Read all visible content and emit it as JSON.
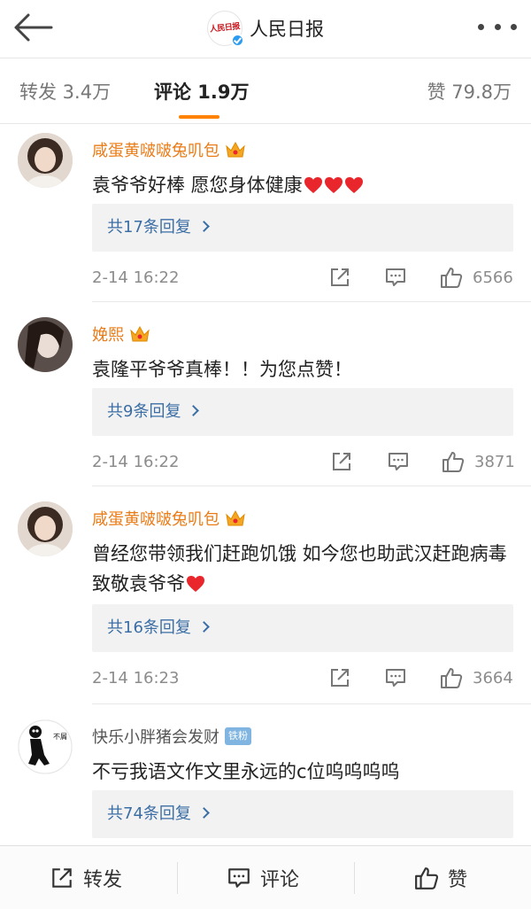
{
  "header": {
    "title": "人民日报",
    "logo_text": "人民日报"
  },
  "tabs": {
    "repost": "转发 3.4万",
    "comments": "评论 1.9万",
    "likes": "赞 79.8万"
  },
  "comments": [
    {
      "user": "咸蛋黄啵啵兔叽包",
      "text": "袁爷爷好棒 愿您身体健康",
      "hearts": 3,
      "replies": "共17条回复",
      "time": "2-14 16:22",
      "likes": "6566"
    },
    {
      "user": "娩熙",
      "text": "袁隆平爷爷真棒！！为您点赞！",
      "hearts": 0,
      "replies": "共9条回复",
      "time": "2-14 16:22",
      "likes": "3871"
    },
    {
      "user": "咸蛋黄啵啵兔叽包",
      "text": "曾经您带领我们赶跑饥饿 如今您也助武汉赶跑病毒 致敬袁爷爷",
      "hearts": 1,
      "replies": "共16条回复",
      "time": "2-14 16:23",
      "likes": "3664"
    },
    {
      "user": "快乐小胖猪会发财",
      "badge": "铁粉",
      "avatar_text": "不屑",
      "text": "不亏我语文作文里永远的c位呜呜呜呜",
      "hearts": 0,
      "replies": "共74条回复"
    }
  ],
  "bottom_bar": {
    "repost": "转发",
    "comment": "评论",
    "like": "赞"
  },
  "colors": {
    "accent": "#ff8200",
    "username": "#ea7c18",
    "link": "#3b6ea5",
    "heart": "#e8262b"
  },
  "icons": [
    "back-arrow-icon",
    "more-icon",
    "verified-icon",
    "crown-icon",
    "heart-icon",
    "repost-icon",
    "comment-icon",
    "thumbs-up-icon",
    "chevron-right-icon"
  ]
}
